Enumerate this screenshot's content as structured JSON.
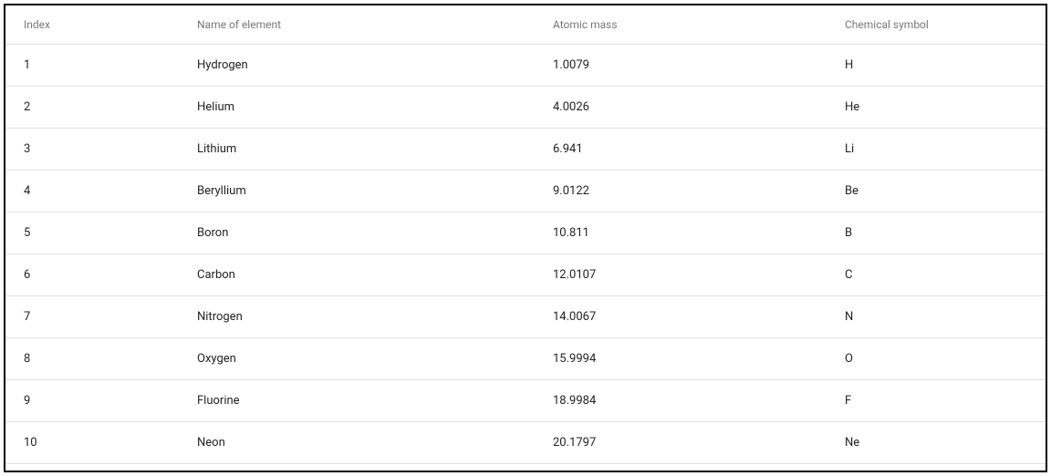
{
  "table": {
    "headers": {
      "index": "Index",
      "name": "Name of element",
      "mass": "Atomic mass",
      "symbol": "Chemical symbol"
    },
    "rows": [
      {
        "index": "1",
        "name": "Hydrogen",
        "mass": "1.0079",
        "symbol": "H"
      },
      {
        "index": "2",
        "name": "Helium",
        "mass": "4.0026",
        "symbol": "He"
      },
      {
        "index": "3",
        "name": "Lithium",
        "mass": "6.941",
        "symbol": "Li"
      },
      {
        "index": "4",
        "name": "Beryllium",
        "mass": "9.0122",
        "symbol": "Be"
      },
      {
        "index": "5",
        "name": "Boron",
        "mass": "10.811",
        "symbol": "B"
      },
      {
        "index": "6",
        "name": "Carbon",
        "mass": "12.0107",
        "symbol": "C"
      },
      {
        "index": "7",
        "name": "Nitrogen",
        "mass": "14.0067",
        "symbol": "N"
      },
      {
        "index": "8",
        "name": "Oxygen",
        "mass": "15.9994",
        "symbol": "O"
      },
      {
        "index": "9",
        "name": "Fluorine",
        "mass": "18.9984",
        "symbol": "F"
      },
      {
        "index": "10",
        "name": "Neon",
        "mass": "20.1797",
        "symbol": "Ne"
      }
    ]
  }
}
